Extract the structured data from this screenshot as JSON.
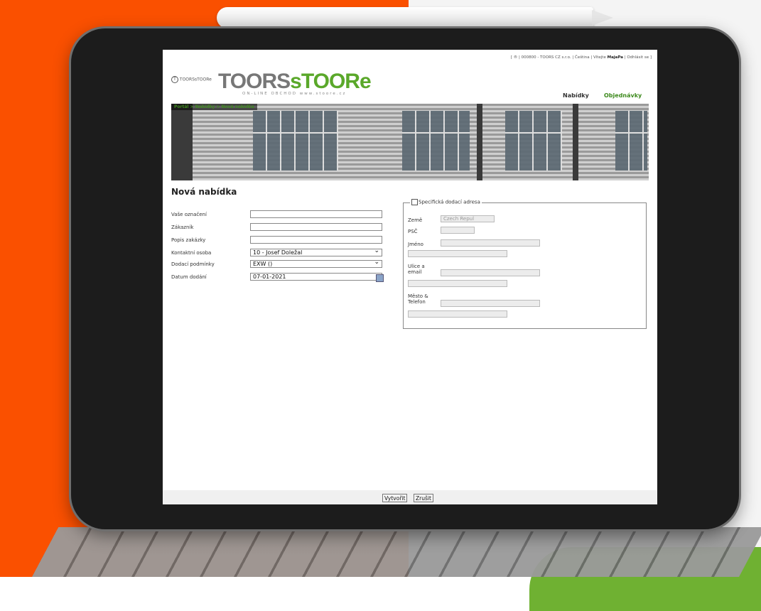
{
  "topbar": {
    "prefix": "[ ® | 000800 - TOORS CZ s.r.o. | Čeština | Vítejte ",
    "user": "MajaPa",
    "logout": "| Odhlásit se ]"
  },
  "logo": {
    "small_mark": "T",
    "small_text": "TOORSsTOORe",
    "big_part1": "TOORS",
    "big_part2": "sTOORe",
    "tagline": "ON-LINE OBCHOD www.stoore.cz"
  },
  "nav": {
    "offers": "Nabídky",
    "orders": "Objednávky"
  },
  "breadcrumb": "Portál > Nabídky > Nová nabídka",
  "form": {
    "title": "Nová nabídka",
    "labels": {
      "designation": "Vaše označení",
      "customer": "Zákazník",
      "description": "Popis zakázky",
      "contact": "Kontaktní osoba",
      "terms": "Dodací podmínky",
      "date": "Datum dodání"
    },
    "values": {
      "designation": "",
      "customer": "",
      "description": "",
      "contact": "10 - Josef Doležal",
      "terms": "EXW ()",
      "date": "07-01-2021"
    }
  },
  "delivery": {
    "legend": "Specifická dodací adresa",
    "country_label": "Země",
    "country_value": "Czech Repul",
    "zip_label": "PSČ",
    "name_label": "Jméno",
    "street_label": "Ulice a email",
    "city_label": "Město & Telefon"
  },
  "buttons": {
    "create": "Vytvořit",
    "cancel": "Zrušit"
  }
}
